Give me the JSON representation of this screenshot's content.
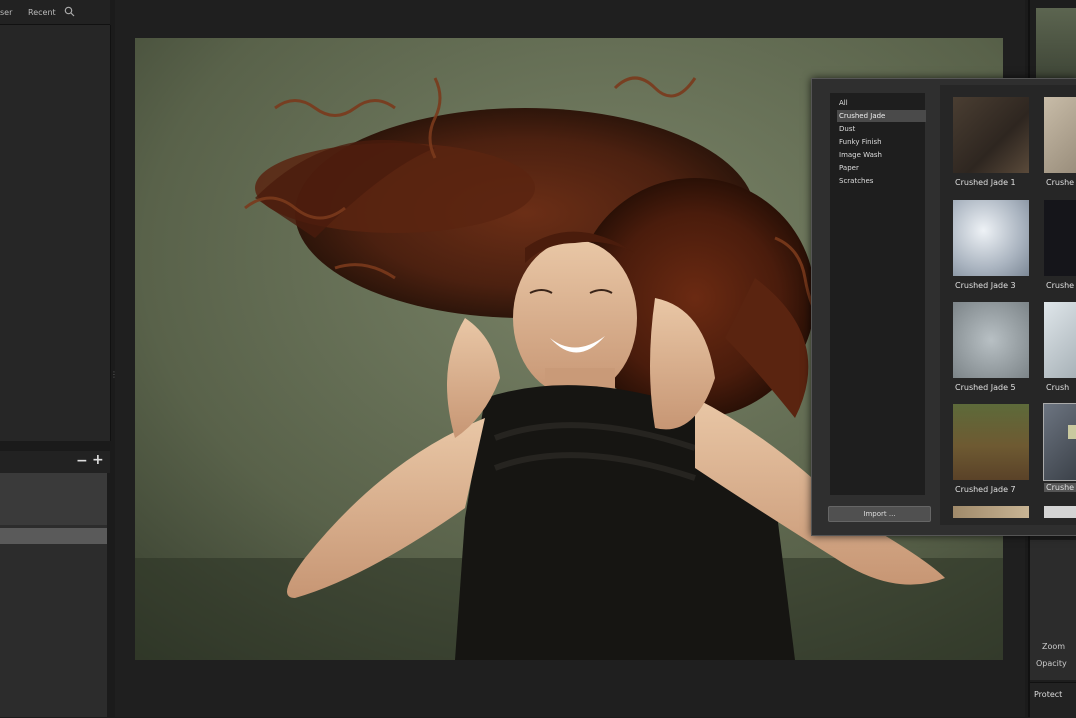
{
  "left_panel": {
    "tabs": [
      "ser",
      "Recent"
    ],
    "minus": "−",
    "plus": "+"
  },
  "popup": {
    "categories": [
      "All",
      "Crushed Jade",
      "Dust",
      "Funky Finish",
      "Image Wash",
      "Paper",
      "Scratches"
    ],
    "selected_category": "Crushed Jade",
    "import_label": "Import ...",
    "thumbnails": [
      {
        "label": "Crushed Jade 1"
      },
      {
        "label": "Crushe"
      },
      {
        "label": "Crushed Jade 3"
      },
      {
        "label": "Crushe"
      },
      {
        "label": "Crushed Jade 5"
      },
      {
        "label": "Crush"
      },
      {
        "label": "Crushed Jade 7"
      },
      {
        "label": "Crushe"
      }
    ]
  },
  "right_panel": {
    "zoom_label": "Zoom",
    "opacity_label": "Opacity",
    "protect_label": "Protect"
  },
  "colors": {
    "background": "#1b1b1b",
    "panel": "#2f2f2f",
    "selection": "#4a4a4a"
  }
}
